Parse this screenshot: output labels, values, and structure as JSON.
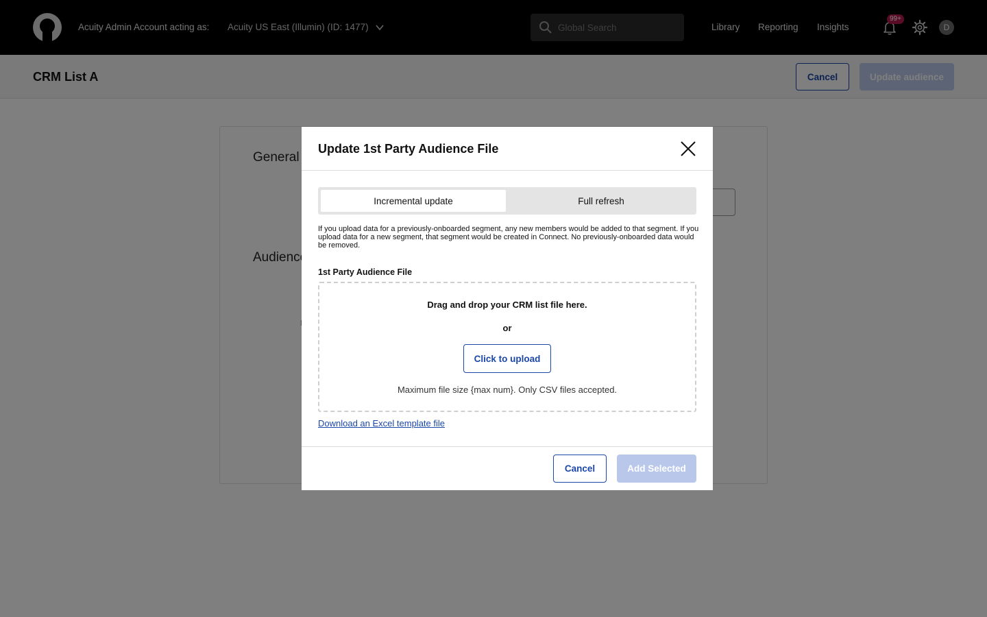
{
  "topbar": {
    "acting_label": "Acuity Admin Account acting as:",
    "account": "Acuity US East (Illumin) (ID: 1477)",
    "search_placeholder": "Global Search",
    "nav": [
      "Library",
      "Reporting",
      "Insights"
    ],
    "notification_count": "99+",
    "avatar_initial": "D"
  },
  "subheader": {
    "title": "CRM List A",
    "cancel_label": "Cancel",
    "update_label": "Update audience"
  },
  "background": {
    "section1": "General",
    "section2": "Audience"
  },
  "modal": {
    "title": "Update 1st Party Audience File",
    "tabs": [
      "Incremental update",
      "Full refresh"
    ],
    "active_tab": "Incremental update",
    "description": "If you upload data for a previously-onboarded segment, any new members would be added to that segment. If you upload data for a new segment, that segment would be created in Connect. No previously-onboarded data would be removed.",
    "field_label": "1st Party Audience File",
    "dropzone": {
      "title": "Drag and drop your CRM list file here.",
      "or": "or",
      "upload_label": "Click to upload",
      "note": "Maximum file size {max num}. Only CSV files accepted."
    },
    "template_link": "Download an Excel template file",
    "cancel_label": "Cancel",
    "add_label": "Add Selected"
  },
  "colors": {
    "accent": "#1b47a8",
    "disabled_primary": "#b9c8ea",
    "badge": "#b5174d",
    "topbar": "#000000"
  },
  "icons": [
    "logo-icon",
    "chevron-down-icon",
    "search-icon",
    "bell-icon",
    "gear-icon",
    "close-icon"
  ]
}
